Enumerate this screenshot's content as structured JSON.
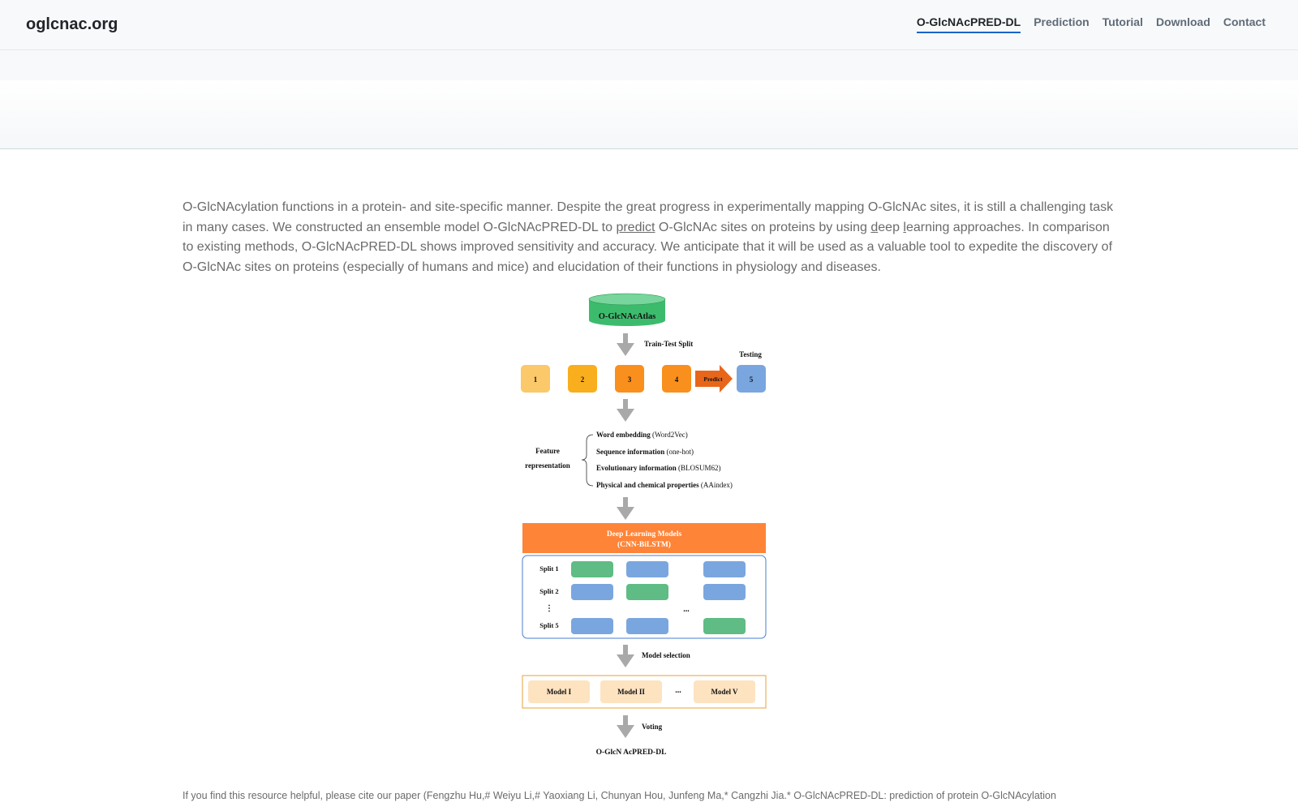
{
  "nav": {
    "brand": "oglcnac.org",
    "links": [
      {
        "label": "O-GlcNAcPRED-DL",
        "active": true
      },
      {
        "label": "Prediction",
        "active": false
      },
      {
        "label": "Tutorial",
        "active": false
      },
      {
        "label": "Download",
        "active": false
      },
      {
        "label": "Contact",
        "active": false
      }
    ]
  },
  "intro": {
    "part1": "O-GlcNAcylation functions in a protein- and site-specific manner. Despite the great progress in experimentally mapping O-GlcNAc sites, it is still a challenging task in many cases. We constructed an ensemble model O-GlcNAcPRED-DL to ",
    "predict_link": "predict",
    "part2": " O-GlcNAc sites on proteins by using ",
    "d": "d",
    "eep": "eep ",
    "l": "l",
    "part3": "earning approaches. In comparison to existing methods, O-GlcNAcPRED-DL shows improved sensitivity and accuracy. We anticipate that it will be used as a valuable tool to expedite the discovery of O-GlcNAc sites on proteins (especially of humans and mice) and elucidation of their functions in physiology and diseases."
  },
  "figure": {
    "database": "O-GlcNAcAtlas",
    "split_label": "Train-Test Split",
    "testing_label": "Testing",
    "predict_label": "Predict",
    "folds": [
      "1",
      "2",
      "3",
      "4",
      "5"
    ],
    "feature_title": [
      "Feature",
      "representation"
    ],
    "features": [
      {
        "bold": "Word embedding",
        "rest": " (Word2Vec)"
      },
      {
        "bold": "Sequence information",
        "rest": " (one-hot)"
      },
      {
        "bold": "Evolutionary information",
        "rest": " (BLOSUM62)"
      },
      {
        "bold": "Physical and chemical properties",
        "rest": " (AAindex)"
      }
    ],
    "dl_title": [
      "Deep Learning Models",
      "(CNN-BiLSTM)"
    ],
    "splits": [
      "Split 1",
      "Split 2",
      "⋮",
      "Split 5"
    ],
    "ellipsis": "...",
    "model_selection": "Model selection",
    "models": [
      "Model I",
      "Model II",
      "...",
      "Model V"
    ],
    "voting": "Voting",
    "output": "O-GlcN AcPRED-DL",
    "colors": {
      "db": "#3dbb6d",
      "fold1": "#fbc86a",
      "fold2": "#f9ae1d",
      "fold3": "#f98f1d",
      "fold4": "#f98f1d",
      "fold5": "#7aa6df",
      "predict_arrow": "#e8661a",
      "dl_header": "#fe8438",
      "green_block": "#5ebc84",
      "blue_block": "#7aa6df",
      "model_block": "#fde3c0",
      "arrow": "#a9a9a9"
    }
  },
  "citation": "If you find this resource helpful, please cite our paper (Fengzhu Hu,# Weiyu Li,# Yaoxiang Li, Chunyan Hou, Junfeng Ma,* Cangzhi Jia.* O-GlcNAcPRED-DL: prediction of protein O-GlcNAcylation"
}
